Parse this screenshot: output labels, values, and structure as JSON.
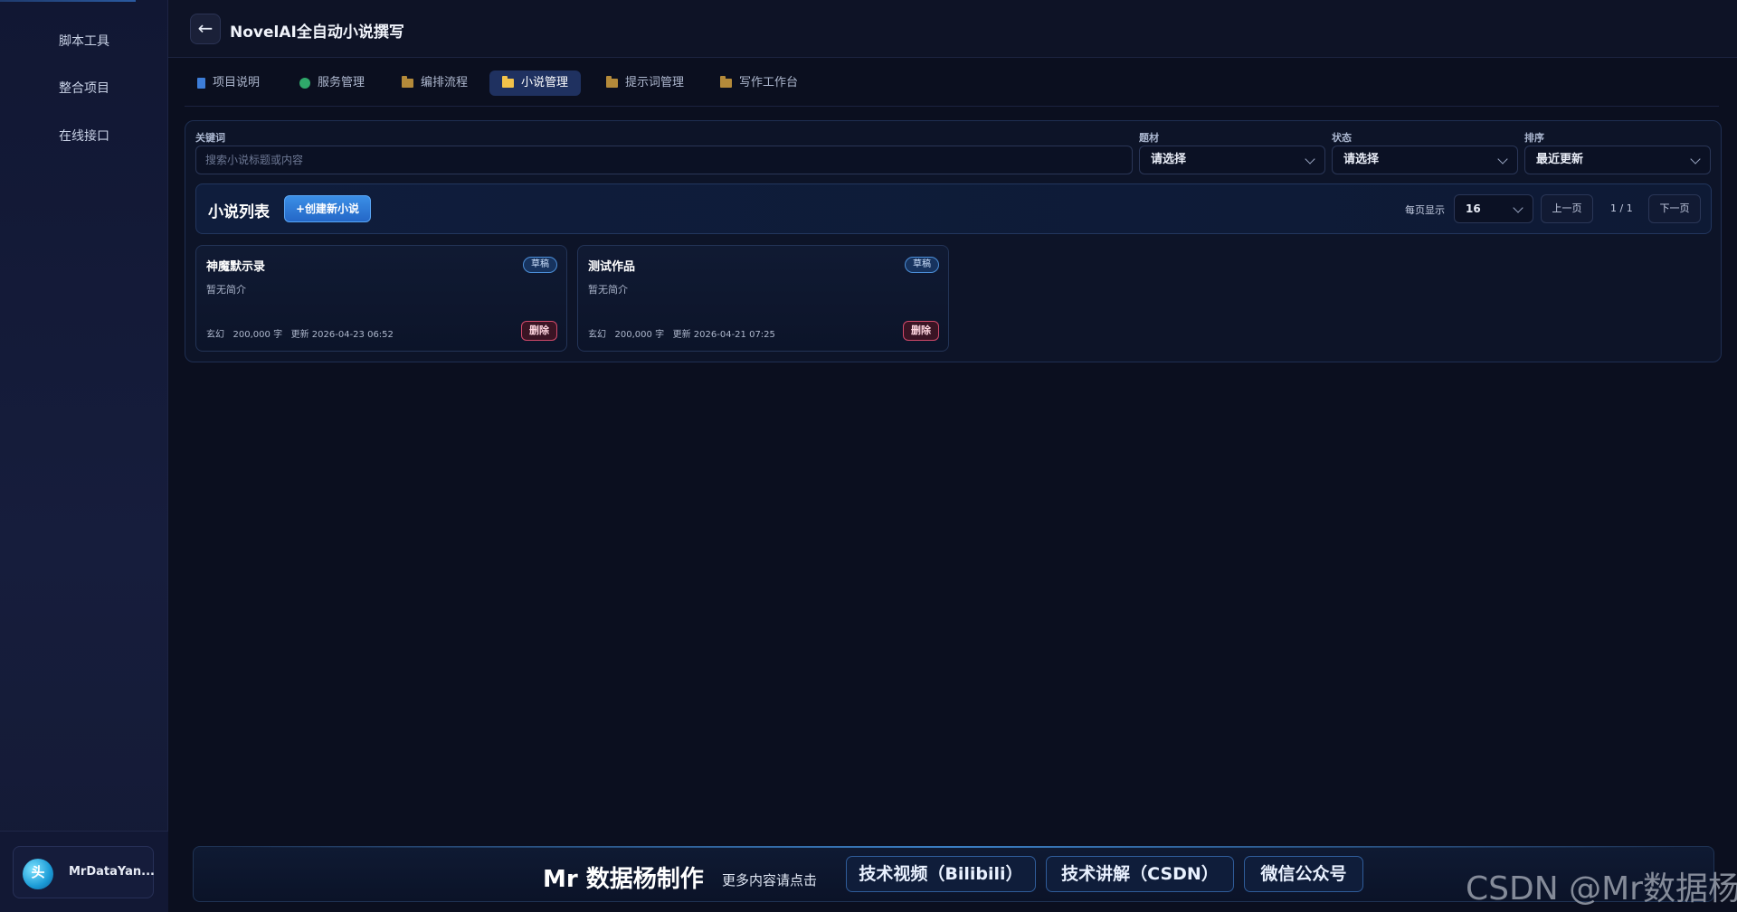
{
  "sidebar": {
    "items": [
      {
        "label": "脚本工具"
      },
      {
        "label": "整合项目"
      },
      {
        "label": "在线接口"
      }
    ],
    "user": {
      "avatar_text": "头",
      "name": "MrDataYan..."
    }
  },
  "header": {
    "back_icon": "←",
    "title": "NovelAI全自动小说撰写"
  },
  "tabs": [
    {
      "label": "项目说明",
      "icon": "book-icon"
    },
    {
      "label": "服务管理",
      "icon": "dot-icon"
    },
    {
      "label": "编排流程",
      "icon": "folder-icon"
    },
    {
      "label": "小说管理",
      "icon": "folder-icon",
      "active": true
    },
    {
      "label": "提示词管理",
      "icon": "folder-icon"
    },
    {
      "label": "写作工作台",
      "icon": "folder-icon"
    }
  ],
  "filters": {
    "keyword_label": "关键词",
    "keyword_placeholder": "搜索小说标题或内容",
    "genre_label": "题材",
    "genre_value": "请选择",
    "status_label": "状态",
    "status_value": "请选择",
    "sort_label": "排序",
    "sort_value": "最近更新"
  },
  "list": {
    "title": "小说列表",
    "create_label": "+创建新小说",
    "per_page_label": "每页显示",
    "per_page_value": "16",
    "prev_label": "上一页",
    "page_info": "1 / 1",
    "next_label": "下一页"
  },
  "novels": [
    {
      "title": "神魔默示录",
      "badge": "草稿",
      "desc": "暂无简介",
      "meta": "玄幻   200,000 字   更新 2026-04-23 06:52",
      "delete_label": "删除"
    },
    {
      "title": "测试作品",
      "badge": "草稿",
      "desc": "暂无简介",
      "meta": "玄幻   200,000 字   更新 2026-04-21 07:25",
      "delete_label": "删除"
    }
  ],
  "footer": {
    "brand": "Mr 数据杨制作",
    "sub": "更多内容请点击",
    "links": [
      {
        "label": "技术视频（Bilibili）"
      },
      {
        "label": "技术讲解（CSDN）"
      },
      {
        "label": "微信公众号"
      }
    ]
  },
  "watermark": "CSDN @Mr数据杨"
}
